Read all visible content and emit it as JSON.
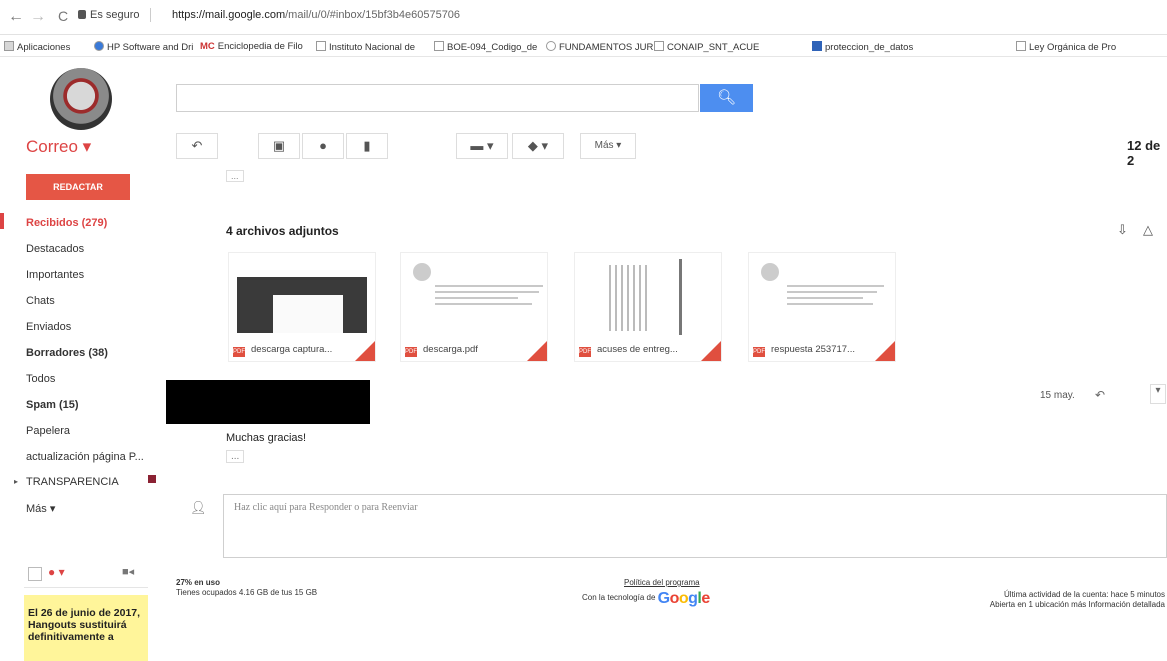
{
  "browser": {
    "nav_back": "←",
    "nav_forward": "→",
    "reload": "C",
    "secure_label": "Es seguro",
    "url_host": "https://mail.google.com",
    "url_path": "/mail/u/0/#inbox/15bf3b4e60575706",
    "bookmarks": [
      "Aplicaciones",
      "HP Software and Dri",
      "Enciclopedia de Filo",
      "Instituto Nacional de",
      "BOE-094_Codigo_de",
      "FUNDAMENTOS JUR",
      "CONAIP_SNT_ACUE",
      "proteccion_de_datos",
      "Ley Orgánica de Pro"
    ]
  },
  "header": {
    "search_placeholder": "",
    "search_icon": "search-icon",
    "app_label": "Correo ▾",
    "toolbar": {
      "more_label": "Más ▾"
    },
    "counter": "12 de 2"
  },
  "sidebar": {
    "compose_label": "REDACTAR",
    "items": [
      "Recibidos (279)",
      "Destacados",
      "Importantes",
      "Chats",
      "Enviados",
      "Borradores (38)",
      "Todos",
      "Spam (15)",
      "Papelera",
      "actualización página P...",
      "TRANSPARENCIA",
      "Más ▾"
    ]
  },
  "message": {
    "ellipsis": "...",
    "attachments_title": "4 archivos adjuntos",
    "attachments": [
      {
        "name": "descarga captura...",
        "type": "PDF"
      },
      {
        "name": "descarga.pdf",
        "type": "PDF"
      },
      {
        "name": "acuses de entreg...",
        "type": "PDF"
      },
      {
        "name": "respuesta 253717...",
        "type": "PDF"
      }
    ],
    "date": "15 may.",
    "body": "Muchas gracias!",
    "reply_prompt": "Haz clic aquí para Responder o para Reenviar",
    "reply_link": "Responder",
    "forward_link": "Reenviar"
  },
  "footer": {
    "storage_pct": "27% en uso",
    "storage_detail": "Tienes ocupados 4.16 GB de tus 15 GB",
    "policy": "Política del programa",
    "powered_by": "Con la tecnología de",
    "google": "Google",
    "activity_line1": "Última actividad de la cuenta: hace 5 minutos",
    "activity_line2": "Abierta en 1 ubicación más Información detallada"
  },
  "hangouts": {
    "note": "El 26 de junio de 2017, Hangouts sustituirá definitivamente a"
  }
}
